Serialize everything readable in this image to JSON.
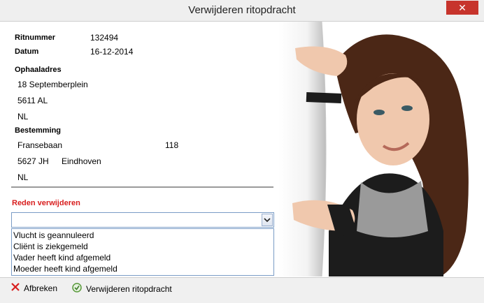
{
  "window": {
    "title": "Verwijderen ritopdracht",
    "close_glyph": "✕"
  },
  "ride": {
    "number_label": "Ritnummer",
    "number": "132494",
    "date_label": "Datum",
    "date": "16-12-2014"
  },
  "pickup": {
    "label": "Ophaaladres",
    "line1": "18 Septemberplein",
    "line2": "5611 AL",
    "line3": "NL"
  },
  "destination": {
    "label": "Bestemming",
    "street": "Fransebaan",
    "house_number": "118",
    "postcode": "5627 JH",
    "city": "Eindhoven",
    "country": "NL"
  },
  "reason": {
    "label": "Reden verwijderen",
    "selected": "",
    "options": [
      "Vlucht is geannuleerd",
      "Cliënt is ziekgemeld",
      "Vader heeft kind afgemeld",
      "Moeder heeft kind afgemeld"
    ]
  },
  "footer": {
    "cancel_label": "Afbreken",
    "delete_label": "Verwijderen ritopdracht"
  },
  "colors": {
    "accent_red": "#d81e1e",
    "close_red": "#c7342c",
    "border_blue": "#7a9cc6"
  },
  "icons": {
    "cancel": "close-x-icon",
    "delete": "recycle-icon",
    "dropdown": "chevron-down-icon"
  }
}
